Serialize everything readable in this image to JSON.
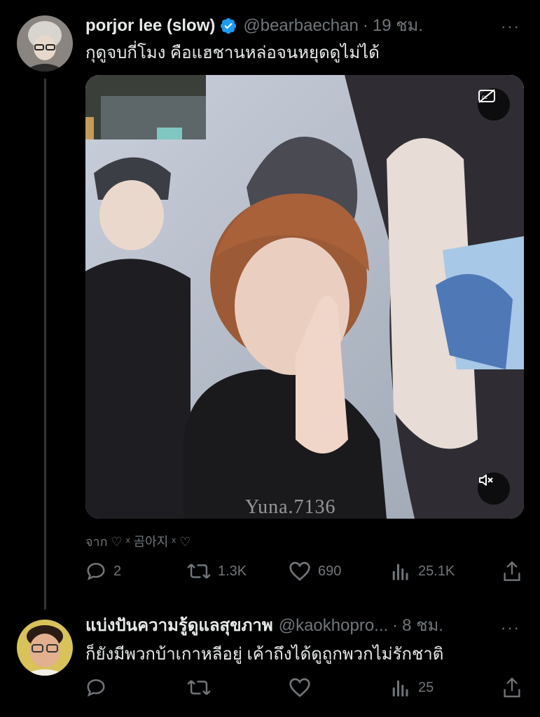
{
  "tweets": [
    {
      "display_name": "porjor lee (slow)",
      "handle": "@bearbaechan",
      "separator": "·",
      "time": "19 ชม.",
      "more": "···",
      "text": "กุดูจบกี่โมง คือแฮชานหล่อจนหยุดดูไม่ได้",
      "media": {
        "watermark": "Yuna.7136",
        "captions_icon": "captions-off-icon",
        "mute_icon": "volume-muted-icon"
      },
      "from": "จาก ♡ ˣ 곰아지 ˣ ♡",
      "actions": {
        "reply": "2",
        "retweet": "1.3K",
        "like": "690",
        "views": "25.1K"
      }
    },
    {
      "display_name": "แบ่งปันความรู้ดูแลสุขภาพ",
      "handle": "@kaokhopro...",
      "separator": "·",
      "time": "8 ชม.",
      "more": "···",
      "text": "ก็ยังมีพวกบ้าเกาหลีอยู่ เค้าถึงได้ดูถูกพวกไม่รักชาติ",
      "actions": {
        "reply": "",
        "retweet": "",
        "like": "",
        "views": "25"
      }
    }
  ],
  "colors": {
    "background": "#000000",
    "text": "#e7e9ea",
    "muted": "#71767b",
    "verified": "#1d9bf0",
    "thread_line": "#333639"
  }
}
